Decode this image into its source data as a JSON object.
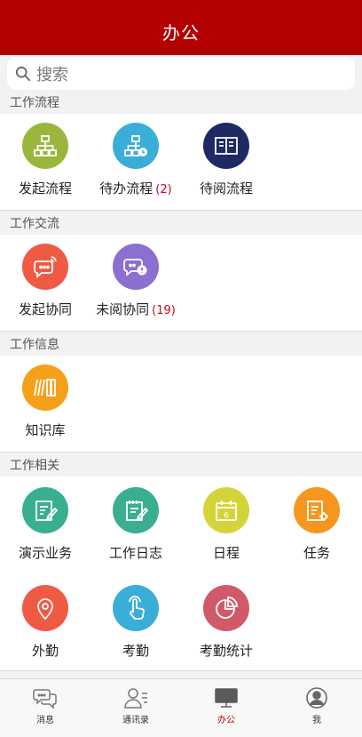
{
  "header": {
    "title": "办公"
  },
  "search": {
    "placeholder": "搜索"
  },
  "sections": [
    {
      "title": "工作流程",
      "items": [
        {
          "label": "发起流程",
          "icon": "org-chart-icon",
          "color": "#9ab73d"
        },
        {
          "label": "待办流程",
          "badge": "(2)",
          "icon": "org-chart-clock-icon",
          "color": "#3aaed8"
        },
        {
          "label": "待阅流程",
          "icon": "open-book-icon",
          "color": "#1d2a63"
        }
      ]
    },
    {
      "title": "工作交流",
      "items": [
        {
          "label": "发起协同",
          "icon": "chat-wave-icon",
          "color": "#ef5a45"
        },
        {
          "label": "未阅协同",
          "badge": "(19)",
          "icon": "chat-alert-icon",
          "color": "#8c6fd1"
        }
      ]
    },
    {
      "title": "工作信息",
      "items": [
        {
          "label": "知识库",
          "icon": "books-icon",
          "color": "#f6a019"
        }
      ]
    },
    {
      "title": "工作相关",
      "items": [
        {
          "label": "演示业务",
          "icon": "note-edit-icon",
          "color": "#3aae93"
        },
        {
          "label": "工作日志",
          "icon": "notepad-edit-icon",
          "color": "#3aae93"
        },
        {
          "label": "日程",
          "icon": "calendar-icon",
          "color": "#d4d43a"
        },
        {
          "label": "任务",
          "icon": "task-gear-icon",
          "color": "#f5971f"
        },
        {
          "label": "外勤",
          "icon": "location-pin-icon",
          "color": "#ef5a45"
        },
        {
          "label": "考勤",
          "icon": "hand-tap-icon",
          "color": "#3aaed8"
        },
        {
          "label": "考勤统计",
          "icon": "pie-chart-icon",
          "color": "#d05a6a"
        }
      ]
    }
  ],
  "tabbar": [
    {
      "label": "消息",
      "icon": "chat-bubbles-icon"
    },
    {
      "label": "通讯录",
      "icon": "contacts-icon"
    },
    {
      "label": "办公",
      "icon": "monitor-icon",
      "active": true
    },
    {
      "label": "我",
      "icon": "user-circle-icon"
    }
  ],
  "colors": {
    "header": "#b30000",
    "badge": "#d0021b",
    "active_tab": "#b30000"
  }
}
